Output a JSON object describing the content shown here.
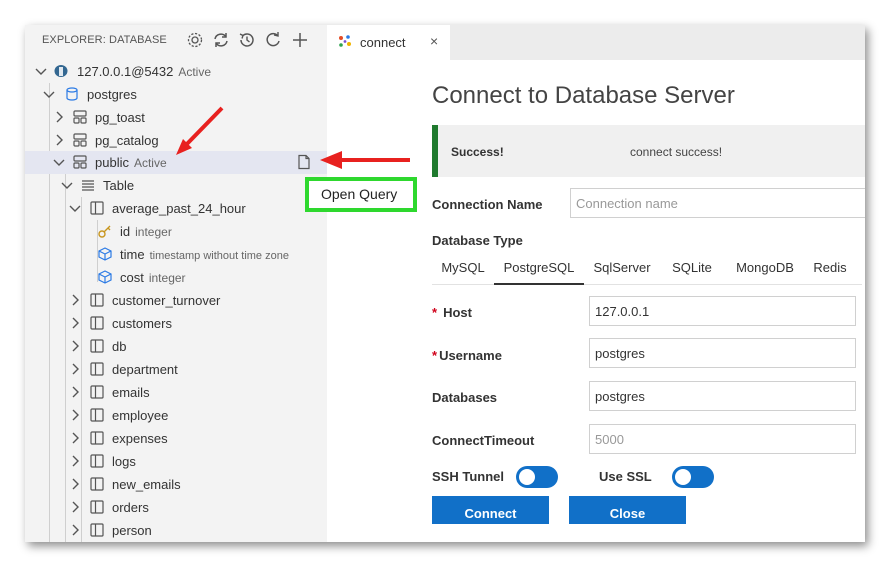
{
  "explorer": {
    "title": "EXPLORER: DATABASE",
    "actions": [
      "settings-icon",
      "refresh-icon",
      "history-icon",
      "reload-icon",
      "add-icon"
    ]
  },
  "tree": {
    "connection": {
      "label": "127.0.0.1@5432",
      "status": "Active"
    },
    "database": {
      "label": "postgres"
    },
    "schemas": [
      {
        "label": "pg_toast"
      },
      {
        "label": "pg_catalog"
      },
      {
        "label": "public",
        "status": "Active"
      }
    ],
    "table_group": {
      "label": "Table"
    },
    "open_table": {
      "label": "average_past_24_hour",
      "columns": [
        {
          "name": "id",
          "type": "integer"
        },
        {
          "name": "time",
          "type": "timestamp without time zone"
        },
        {
          "name": "cost",
          "type": "integer"
        }
      ]
    },
    "tables": [
      "customer_turnover",
      "customers",
      "db",
      "department",
      "emails",
      "employee",
      "expenses",
      "logs",
      "new_emails",
      "orders",
      "person"
    ]
  },
  "tab": {
    "label": "connect",
    "close": "×"
  },
  "page": {
    "title": "Connect to Database Server"
  },
  "alert": {
    "title": "Success!",
    "message": "connect success!"
  },
  "form": {
    "connection_name": {
      "label": "Connection Name",
      "placeholder": "Connection name",
      "value": ""
    },
    "database_type": {
      "label": "Database Type",
      "options": [
        "MySQL",
        "PostgreSQL",
        "SqlServer",
        "SQLite",
        "MongoDB",
        "Redis"
      ],
      "selected": "PostgreSQL"
    },
    "host": {
      "required": "*",
      "label": "Host",
      "value": "127.0.0.1"
    },
    "username": {
      "required": "*",
      "label": "Username",
      "value": "postgres"
    },
    "databases": {
      "label": "Databases",
      "value": "postgres"
    },
    "connect_timeout": {
      "label": "ConnectTimeout",
      "placeholder": "5000",
      "value": ""
    },
    "ssh_tunnel": {
      "label": "SSH Tunnel",
      "enabled": false
    },
    "use_ssl": {
      "label": "Use SSL",
      "enabled": false
    },
    "connect_button": "Connect",
    "close_button": "Close"
  },
  "callout": {
    "label": "Open Query"
  },
  "colors": {
    "accent": "#1170c8",
    "success_bar": "#1f7a2e",
    "callout_border": "#2ed82e",
    "arrow": "#e8211f"
  }
}
